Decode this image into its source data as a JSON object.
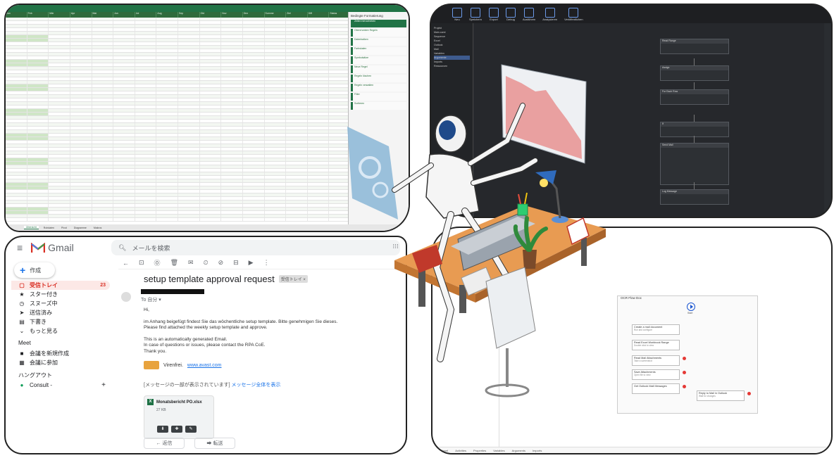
{
  "excel": {
    "columns": [
      "Jan",
      "Feb",
      "Mär",
      "Apr",
      "Mai",
      "Jun",
      "Jul",
      "Aug",
      "Sep",
      "Okt",
      "Nov",
      "Dez",
      "Summe",
      "Ziel",
      "Diff",
      "Status"
    ],
    "pane_title": "Bedingte Formatierung",
    "pane_items": [
      "Zellen hervorheben",
      "Obere/untere Regeln",
      "Datenbalken",
      "Farbskalen",
      "Symbolsätze",
      "Neue Regel",
      "Regeln löschen",
      "Regeln verwalten",
      "Filter",
      "Sortieren"
    ],
    "tabs": [
      "Übersicht",
      "Rohdaten",
      "Pivot",
      "Diagramme",
      "Makros"
    ]
  },
  "studio": {
    "ribbon": [
      "Neu",
      "Speichern",
      "Export",
      "Debug",
      "Ausführen",
      "Analysieren",
      "Veröffentlichen"
    ],
    "tree": [
      "Projekt",
      "Main.xaml",
      "Sequence",
      "Excel",
      "Outlook",
      "Mail",
      "Variablen",
      "Argumente",
      "Imports",
      "Ressourcen"
    ],
    "blocks": [
      "Read Range",
      "Assign",
      "For Each Row",
      "If",
      "Send Mail",
      "Log Message"
    ]
  },
  "gmail": {
    "menu_icon": "≡",
    "app_name": "Gmail",
    "search_placeholder": "メールを検索",
    "apps_icon": "⁝⁝⁝",
    "compose": "作成",
    "nav": [
      {
        "icon": "▢",
        "label": "受信トレイ",
        "count": "23"
      },
      {
        "icon": "★",
        "label": "スター付き",
        "count": ""
      },
      {
        "icon": "◷",
        "label": "スヌーズ中",
        "count": ""
      },
      {
        "icon": "➤",
        "label": "送信済み",
        "count": ""
      },
      {
        "icon": "▤",
        "label": "下書き",
        "count": ""
      },
      {
        "icon": "⌄",
        "label": "もっと見る",
        "count": ""
      }
    ],
    "meet_label": "Meet",
    "meet_items": [
      {
        "icon": "■",
        "label": "会議を新規作成"
      },
      {
        "icon": "▦",
        "label": "会議に参加"
      }
    ],
    "hangouts_label": "ハングアウト",
    "hangouts_user": "Consult -",
    "hangouts_add": "+",
    "toolbar": [
      "←",
      "⊡",
      "⓪",
      "🗑",
      "✉",
      "⏲",
      "⊘",
      "⊟",
      "▶",
      "⋮"
    ],
    "subject": "setup template approval request",
    "subject_label": "受信トレイ ×",
    "to": "To 自分 ▾",
    "body": [
      "Hi,",
      "im Anhang beigefügt findest Sie das wöchentliche setup template. Bitte genehmigen Sie dieses.",
      "Please find attached the weekly setup template and approve.",
      "This is an automatically generated Email.",
      "In case of questions or issues, please contact the RPA CoE.",
      "Thank you."
    ],
    "signature": "Virenfrei.",
    "signature_link": "www.avast.com",
    "truncated": "[メッセージの一部が表示されています]",
    "truncated_link": "メッセージ全体を表示",
    "attachment_icon": "X",
    "attachment_name": "Monatsbericht PO.xlsx",
    "attachment_size": "27 KB",
    "attachment_actions": [
      "⬇",
      "✚",
      "✎"
    ],
    "reply": "← 返信",
    "forward": "➡ 転送"
  },
  "flow": {
    "box_title": "OCR Flow Doc",
    "start_label": "Start",
    "activities": [
      {
        "title": "Create a mail document",
        "sub": "Run and configure"
      },
      {
        "title": "Read Excel Workbook Range",
        "sub": "Double click to view"
      },
      {
        "title": "Read Mail Attachments",
        "sub": "Take a screenshot"
      },
      {
        "title": "Save Attachments",
        "sub": "Open file to view"
      },
      {
        "title": "Get Outlook Mail Messages",
        "sub": ""
      },
      {
        "title": "Reply to Mail in Outlook",
        "sub": "Wait for changes"
      }
    ],
    "bottom_tabs": [
      "Variables",
      "Arguments",
      "Imports"
    ],
    "bottom_left": [
      "Panel",
      "Activities",
      "Properties"
    ]
  }
}
